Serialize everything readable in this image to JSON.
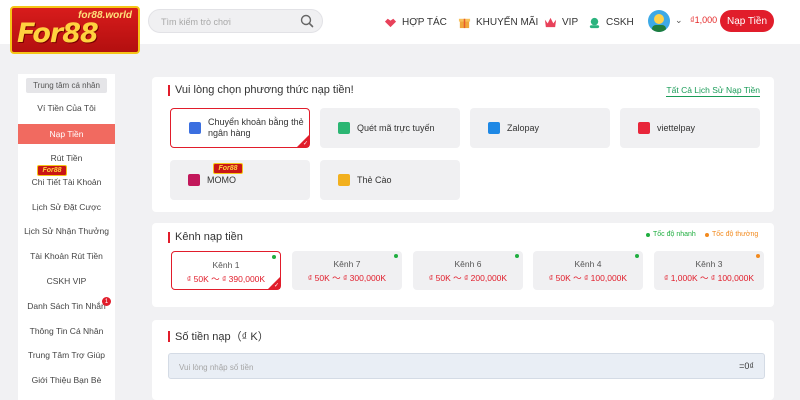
{
  "header": {
    "logo_text": "For88",
    "logo_domain": "for88.world",
    "search_placeholder": "Tìm kiếm trò chơi",
    "nav": [
      {
        "label": "HỢP TÁC",
        "icon": "handshake-icon"
      },
      {
        "label": "KHUYẾN MÃI",
        "icon": "gift-icon"
      },
      {
        "label": "VIP",
        "icon": "crown-icon"
      },
      {
        "label": "CSKH",
        "icon": "headset-icon"
      }
    ],
    "balance": "₫1,000",
    "topup_label": "Nạp Tiền"
  },
  "sidebar": {
    "title": "Trung tâm cá nhân",
    "mini_logo": "For88",
    "items": [
      {
        "label": "Ví Tiền Của Tôi"
      },
      {
        "label": "Nạp Tiền",
        "active": true
      },
      {
        "label": "Rút Tiền"
      },
      {
        "label": "Chi Tiết Tài Khoản"
      },
      {
        "label": "Lịch Sử Đặt Cược"
      },
      {
        "label": "Lịch Sử Nhận Thưởng"
      },
      {
        "label": "Tài Khoản Rút Tiền"
      },
      {
        "label": "CSKH VIP"
      },
      {
        "label": "Danh Sách Tin Nhắn",
        "badge": "1"
      },
      {
        "label": "Thông Tin Cá Nhân"
      },
      {
        "label": "Trung Tâm Trợ Giúp"
      },
      {
        "label": "Giới Thiệu Bạn Bè"
      }
    ]
  },
  "methods_panel": {
    "title": "Vui lòng chọn phương thức nạp tiền!",
    "history_link": "Tất Cả Lịch Sử Nạp Tiền",
    "methods": [
      {
        "label": "Chuyển khoản bằng thẻ ngân hàng",
        "active": true,
        "icon": "bank-card-icon",
        "color": "#3b6fe0"
      },
      {
        "label": "Quét mã trực tuyến",
        "icon": "qr-scan-icon",
        "color": "#2bb673"
      },
      {
        "label": "Zalopay",
        "icon": "zalopay-icon",
        "color": "#1e88e5"
      },
      {
        "label": "viettelpay",
        "icon": "viettelpay-icon",
        "color": "#e8263a"
      },
      {
        "label": "MOMO",
        "icon": "momo-icon",
        "color": "#c2185b"
      },
      {
        "label": "Thẻ Cào",
        "icon": "scratch-card-icon",
        "color": "#f2b01e"
      }
    ],
    "method_overlay_logo": "For88"
  },
  "channels_panel": {
    "title": "Kênh nạp tiền",
    "legend_fast": "Tốc độ nhanh",
    "legend_normal": "Tốc độ thường",
    "legend_fast_color": "#1fae3f",
    "legend_normal_color": "#f28a1e",
    "channels": [
      {
        "name": "Kênh 1",
        "range": "₫ 50K ～ ₫ 390,000K",
        "active": true,
        "speed": "fast"
      },
      {
        "name": "Kênh 7",
        "range": "₫ 50K ～ ₫ 300,000K",
        "speed": "fast"
      },
      {
        "name": "Kênh 6",
        "range": "₫ 50K ～ ₫ 200,000K",
        "speed": "fast"
      },
      {
        "name": "Kênh 4",
        "range": "₫ 50K ～ ₫ 100,000K",
        "speed": "fast"
      },
      {
        "name": "Kênh 3",
        "range": "₫ 1,000K ～ ₫ 100,000K",
        "speed": "normal"
      }
    ]
  },
  "amount_panel": {
    "title": "Số tiền nạp（₫ K）",
    "placeholder": "Vui lòng nhập số tiền",
    "converted": "=0₫"
  },
  "colors": {
    "accent": "#e11d2b",
    "sidebar_active": "#f16a60",
    "link_green": "#1a9c58"
  }
}
